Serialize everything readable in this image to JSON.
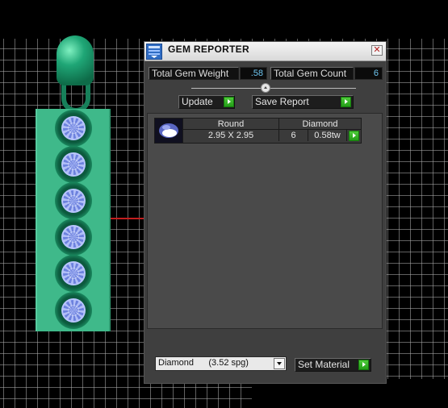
{
  "panel": {
    "title": "GEM REPORTER",
    "close_glyph": "✕",
    "total_weight_label": "Total Gem Weight",
    "total_weight_value": ".58",
    "total_count_label": "Total Gem Count",
    "total_count_value": "6",
    "update_label": "Update",
    "save_label": "Save Report",
    "set_material_label": "Set Material"
  },
  "gem_table": {
    "headers": [
      "Round",
      "Diamond"
    ],
    "row": {
      "size": "2.95 X 2.95",
      "count": "6",
      "weight": "0.58tw"
    }
  },
  "material_select": {
    "value": "Diamond      (3.52 spg)"
  },
  "icons": {
    "app": "gem-reporter-icon",
    "close": "close-icon",
    "action": "green-arrow-icon",
    "gem": "round-gem-icon",
    "dropdown": "chevron-down-icon"
  },
  "colors": {
    "panel_bg": "#3f3f3f",
    "value_text": "#6fc7f2",
    "action_green": "#34b426",
    "pendant": "#3fb98a",
    "gem": "#8fa0ec"
  }
}
